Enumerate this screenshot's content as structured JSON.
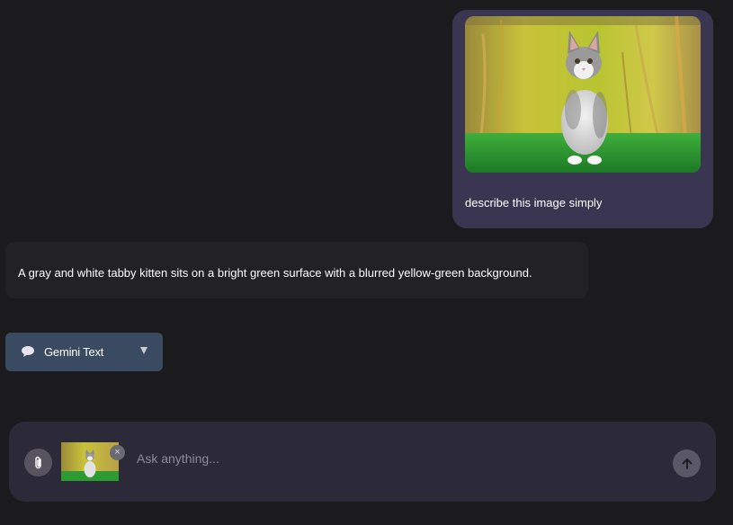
{
  "conversation": {
    "user_message": {
      "text": "describe this image simply",
      "image_alt": "kitten-photo"
    },
    "assistant_message": {
      "text": "A gray and white tabby kitten sits on a bright green surface with a blurred yellow-green background."
    }
  },
  "model_selector": {
    "label": "Gemini Text",
    "icon": "speech-bubble-icon"
  },
  "composer": {
    "placeholder": "Ask anything...",
    "value": "",
    "attachment_icon": "paperclip-icon",
    "send_icon": "arrow-up-icon",
    "remove_glyph": "×"
  },
  "colors": {
    "background": "#1b1b1d",
    "user_bubble": "#3a3550",
    "assistant_bubble": "#222224",
    "model_selector": "#3a4a60",
    "composer": "#2c2a38"
  }
}
